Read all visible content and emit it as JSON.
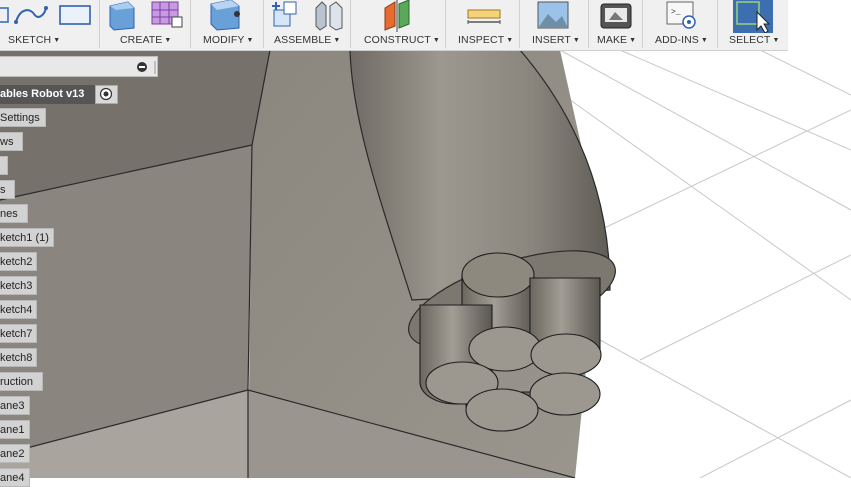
{
  "toolbar": {
    "groups": [
      {
        "label": "SKETCH"
      },
      {
        "label": "CREATE"
      },
      {
        "label": "MODIFY"
      },
      {
        "label": "ASSEMBLE"
      },
      {
        "label": "CONSTRUCT"
      },
      {
        "label": "INSPECT"
      },
      {
        "label": "INSERT"
      },
      {
        "label": "MAKE"
      },
      {
        "label": "ADD-INS"
      },
      {
        "label": "SELECT"
      }
    ]
  },
  "browser": {
    "root": "ables Robot v13",
    "items": [
      "Settings",
      "ws",
      "",
      "s",
      "nes",
      "ketch1 (1)",
      "ketch2",
      "ketch3",
      "ketch4",
      "ketch7",
      "ketch8",
      "ruction",
      "ane3",
      "ane1",
      "ane2",
      "ane4"
    ]
  },
  "colors": {
    "toolbar_bg": "#f0f0f0",
    "select_active": "#3d6fb0",
    "model_face": "#8f8b84",
    "model_dark": "#6e6a63",
    "viewport_bg": "#ffffff"
  }
}
